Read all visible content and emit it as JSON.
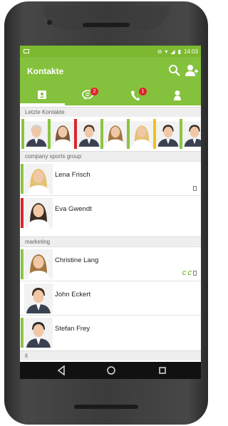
{
  "status_bar": {
    "time": "14:03",
    "icons": [
      "image-icon",
      "minus-circle-icon",
      "wifi-icon",
      "signal-icon",
      "battery-icon"
    ]
  },
  "app_bar": {
    "title": "Kontakte",
    "icons": [
      "search-icon",
      "add-person-icon"
    ]
  },
  "tabs": [
    {
      "icon": "contacts-card-icon",
      "badge": null,
      "active": true
    },
    {
      "icon": "chat-icon",
      "badge": "2",
      "active": false
    },
    {
      "icon": "phone-icon",
      "badge": "1",
      "active": false
    },
    {
      "icon": "person-icon",
      "badge": null,
      "active": false
    }
  ],
  "recent": {
    "header": "Letzte Kontakte",
    "items": [
      {
        "status_color": "#8bc53f",
        "gender": "m",
        "hair": "#cfcfcf"
      },
      {
        "status_color": "#8bc53f",
        "gender": "f",
        "hair": "#7b5a3c"
      },
      {
        "status_color": "#d9262b",
        "gender": "m",
        "hair": "#4a3a2c"
      },
      {
        "status_color": "#8bc53f",
        "gender": "f",
        "hair": "#a4763f"
      },
      {
        "status_color": "#8bc53f",
        "gender": "f",
        "hair": "#e3c270"
      },
      {
        "status_color": "#f0c020",
        "gender": "m",
        "hair": "#2d2d2d"
      },
      {
        "status_color": "#8bc53f",
        "gender": "m",
        "hair": "#3b2d22"
      }
    ]
  },
  "groups": [
    {
      "header": "company sports group",
      "contacts": [
        {
          "name": "Lena Frisch",
          "status_color": "#8bc53f",
          "gender": "f",
          "hair": "#e3c270",
          "indicators": [
            "device"
          ]
        },
        {
          "name": "Eva Gwendt",
          "status_color": "#d9262b",
          "gender": "f",
          "hair": "#3b2d22",
          "indicators": []
        }
      ]
    },
    {
      "header": "marketing",
      "contacts": [
        {
          "name": "Christine Lang",
          "status_color": "#8bc53f",
          "gender": "f",
          "hair": "#a4763f",
          "indicators": [
            "c",
            "c",
            "device"
          ]
        },
        {
          "name": "John Eckert",
          "status_color": "#ffffff",
          "gender": "m",
          "hair": "#3b2d22",
          "indicators": []
        },
        {
          "name": "Stefan Frey",
          "status_color": "#8bc53f",
          "gender": "m",
          "hair": "#2d2d2d",
          "indicators": []
        }
      ]
    },
    {
      "header": "it",
      "contacts": []
    }
  ],
  "nav_bar": {
    "icons": [
      "back-triangle-icon",
      "home-circle-icon",
      "recents-square-icon"
    ]
  }
}
